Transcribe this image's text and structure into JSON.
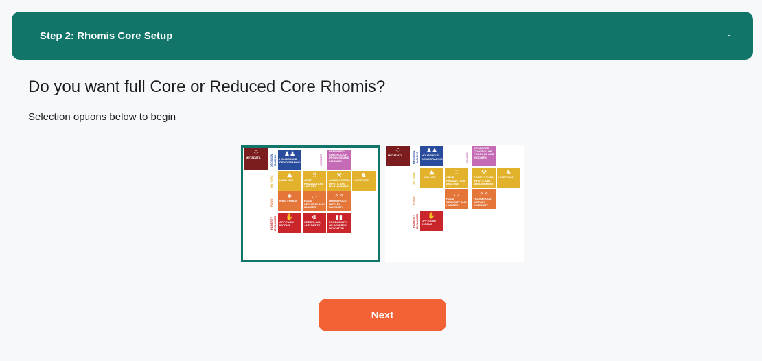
{
  "header": {
    "title": "Step 2: Rhomis Core Setup",
    "toggle": "-"
  },
  "main": {
    "question": "Do you want full Core or Reduced Core Rhomis?",
    "instruction": "Selection options below to begin"
  },
  "options": {
    "full": {
      "selected": true,
      "labels": {
        "metadata": "METADATA",
        "decision_making": "DECISION MAKING",
        "household": "HOUSEHOLD DEMOGRAPHICS",
        "gender": "GENDER",
        "gendered_control": "GENDERED CONTROL OF PRODUCE AND INCOMES",
        "on_farm": "ON FARM",
        "land_use": "LAND USE",
        "crop_production": "CROP PRODUCTION AND USE",
        "ag_inputs": "AGRICULTURAL INPUTS AND MANAGEMENT",
        "livestock": "LIVESTOCK",
        "food": "FOOD",
        "wild_foods": "WILD FOODS",
        "food_security": "FOOD SECURITY AND HUNGER",
        "dietary_diversity": "HOUSEHOLD DIETARY DIVERSITY",
        "poverty_dynamics": "POVERTY DYNAMICS",
        "off_farm": "OFF-FARM INCOME",
        "credit": "CREDIT, AID, AND DEBTS",
        "ppi": "PROBABILITY OF POVERTY INDICATOR"
      }
    },
    "reduced": {
      "selected": false,
      "labels": {
        "metadata": "METADATA",
        "decision_making": "DECISION MAKING",
        "household": "HOUSEHOLD DEMOGRAPHICS",
        "gender": "GENDER",
        "gendered_control": "GENDERED CONTROL OF PRODUCE AND INCOMES",
        "on_farm": "ON FARM",
        "land_use": "LAND USE",
        "crop_production": "CROP PRODUCTION AND USE",
        "ag_inputs": "AGRICULTURAL INPUTS AND MANAGEMENT",
        "livestock": "LIVESTOCK",
        "food": "FOOD",
        "food_security": "FOOD SECURITY AND HUNGER",
        "dietary_diversity": "HOUSEHOLD DIETARY DIVERSITY",
        "poverty_dynamics": "POVERTY DYNAMICS",
        "off_farm": "OFF-FARM INCOME"
      }
    }
  },
  "actions": {
    "next_label": "Next"
  },
  "colors": {
    "primary": "#11756a",
    "accent": "#f26234",
    "metadata": "#7b1d1f",
    "household": "#2a4c9c",
    "gender": "#c56bb5",
    "on_farm": "#e2b22c",
    "food": "#e4763a",
    "poverty": "#c9252b"
  }
}
